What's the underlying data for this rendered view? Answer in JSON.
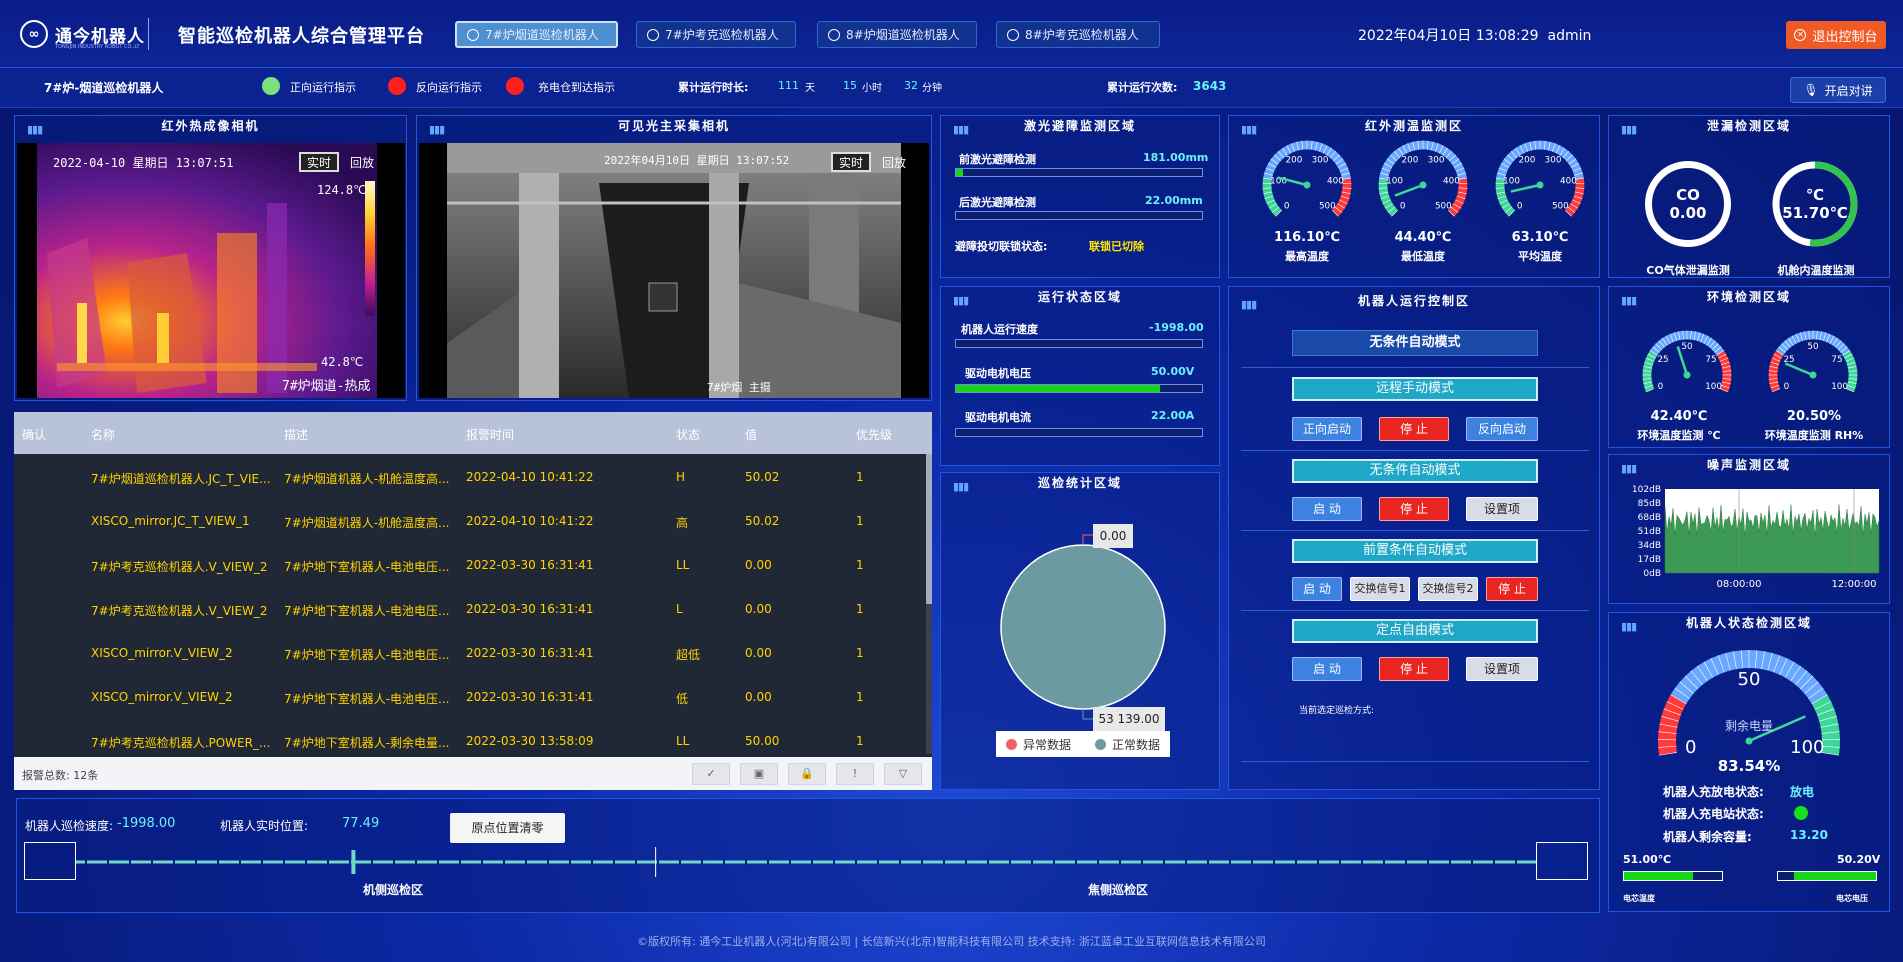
{
  "header": {
    "logo_mark": "∞",
    "logo_text": "通今机器人",
    "logo_sub": "TONGJIN INDUSTRY ROBOT CO.,LTD",
    "title": "智能巡检机器人综合管理平台",
    "tabs": [
      "7#炉烟道巡检机器人",
      "7#炉考克巡检机器人",
      "8#炉烟道巡检机器人",
      "8#炉考克巡检机器人"
    ],
    "active_tab": 0,
    "datetime": "2022年04月10日 13:08:29",
    "user": "admin",
    "logout": "退出控制台"
  },
  "status": {
    "robot_name": "7#炉-烟道巡检机器人",
    "legend": [
      {
        "label": "正向运行指示",
        "color": "#7de07d"
      },
      {
        "label": "反向运行指示",
        "color": "#ff1f1f"
      },
      {
        "label": "充电仓到达指示",
        "color": "#ff1f1f"
      }
    ],
    "runtime_label": "累计运行时长:",
    "days": "111",
    "days_unit": "天",
    "hours": "15",
    "hours_unit": "小时",
    "minutes": "32",
    "minutes_unit": "分钟",
    "count_label": "累计运行次数:",
    "count": "3643",
    "talk": "开启对讲"
  },
  "thermal": {
    "title": "红外热成像相机",
    "date": "2022-04-10 星期日 13:07:51",
    "live": "实时",
    "replay": "回放",
    "max": "124.8℃",
    "min": "42.8℃",
    "name": "7#炉烟道-热成"
  },
  "visible": {
    "title": "可见光主采集相机",
    "date": "2022年04月10日 星期日 13:07:52",
    "live": "实时",
    "replay": "回放",
    "name": "7#炉烟  主摄"
  },
  "alarms": {
    "columns": [
      "确认",
      "名称",
      "描述",
      "报警时间",
      "状态",
      "值",
      "优先级"
    ],
    "rows": [
      [
        "",
        "7#炉烟道巡检机器人.JC_T_VIE...",
        "7#炉烟道机器人-机舱温度高...",
        "2022-04-10 10:41:22",
        "H",
        "50.02",
        "1"
      ],
      [
        "",
        "XISCO_mirror.JC_T_VIEW_1",
        "7#炉烟道机器人-机舱温度高...",
        "2022-04-10 10:41:22",
        "高",
        "50.02",
        "1"
      ],
      [
        "",
        "7#炉考克巡检机器人.V_VIEW_2",
        "7#炉地下室机器人-电池电压...",
        "2022-03-30 16:31:41",
        "LL",
        "0.00",
        "1"
      ],
      [
        "",
        "7#炉考克巡检机器人.V_VIEW_2",
        "7#炉地下室机器人-电池电压...",
        "2022-03-30 16:31:41",
        "L",
        "0.00",
        "1"
      ],
      [
        "",
        "XISCO_mirror.V_VIEW_2",
        "7#炉地下室机器人-电池电压...",
        "2022-03-30 16:31:41",
        "超低",
        "0.00",
        "1"
      ],
      [
        "",
        "XISCO_mirror.V_VIEW_2",
        "7#炉地下室机器人-电池电压...",
        "2022-03-30 16:31:41",
        "低",
        "0.00",
        "1"
      ],
      [
        "",
        "7#炉考克巡检机器人.POWER_...",
        "7#炉地下室机器人-剩余电量...",
        "2022-03-30 13:58:09",
        "LL",
        "50.00",
        "1"
      ]
    ],
    "total": "报警总数: 12条",
    "tools": [
      "✓",
      "▣",
      "🔒",
      "!",
      "▽"
    ]
  },
  "laser": {
    "title": "激光避障监测区域",
    "front_label": "前激光避障检测",
    "front_value": "181.00mm",
    "front_pct": 0.03,
    "rear_label": "后激光避障检测",
    "rear_value": "22.00mm",
    "rear_pct": 0.0,
    "interlock_label": "避障投切联锁状态:",
    "interlock_value": "联锁已切除"
  },
  "runstate": {
    "title": "运行状态区域",
    "speed_label": "机器人运行速度",
    "speed_value": "-1998.00",
    "speed_pct": 0.0,
    "volt_label": "驱动电机电压",
    "volt_value": "50.00V",
    "volt_pct": 0.83,
    "curr_label": "驱动电机电流",
    "curr_value": "22.00A",
    "curr_pct": 0.0
  },
  "stats": {
    "title": "巡检统计区域",
    "abnormal_value": "0.00",
    "normal_value": "53 139.00",
    "legend_abnormal": "异常数据",
    "legend_normal": "正常数据",
    "color_abnormal": "#f06262",
    "color_normal": "#6b9aa0"
  },
  "infrared": {
    "title": "红外测温监测区",
    "gauges": [
      {
        "value": "116.10℃",
        "label": "最高温度",
        "pct": 0.22
      },
      {
        "value": "44.40℃",
        "label": "最低温度",
        "pct": 0.09
      },
      {
        "value": "63.10℃",
        "label": "平均温度",
        "pct": 0.12
      }
    ],
    "ticks": [
      "0",
      "100",
      "200",
      "300",
      "400",
      "500"
    ]
  },
  "control": {
    "title": "机器人运行控制区",
    "current_mode": "无条件自动模式",
    "modes": [
      {
        "name": "远程手动模式",
        "buttons": [
          "正向启动",
          "停 止",
          "反向启动"
        ]
      },
      {
        "name": "无条件自动模式",
        "buttons": [
          "启 动",
          "停 止",
          "设置项"
        ]
      },
      {
        "name": "前置条件自动模式",
        "buttons": [
          "启 动",
          "交换信号1",
          "交换信号2",
          "停 止"
        ]
      },
      {
        "name": "定点自由模式",
        "buttons": [
          "启 动",
          "停 止",
          "设置项"
        ]
      }
    ],
    "selected_label": "当前选定巡检方式:"
  },
  "leak": {
    "title": "泄漏检测区域",
    "co_label": "CO",
    "co_value": "0.00",
    "co_caption": "CO气体泄漏监测",
    "temp_unit": "℃",
    "temp_value": "51.70℃",
    "temp_caption": "机舱内温度监测",
    "temp_pct": 0.52
  },
  "env": {
    "title": "环境检测区域",
    "temp_value": "42.40℃",
    "temp_label": "环境温度监测 ℃",
    "temp_pct": 0.42,
    "hum_value": "20.50%",
    "hum_label": "环境温度监测 RH%",
    "hum_pct": 0.2,
    "ticks": [
      "0",
      "25",
      "50",
      "75",
      "100"
    ]
  },
  "noise": {
    "title": "噪声监测区域",
    "yticks": [
      "102dB",
      "85dB",
      "68dB",
      "51dB",
      "34dB",
      "17dB",
      "0dB"
    ],
    "xticks": [
      "08:00:00",
      "12:00:00"
    ]
  },
  "robotstate": {
    "title": "机器人状态检测区域",
    "gauge_label": "剩余电量",
    "battery_value": "83.54%",
    "battery_pct": 0.8354,
    "ticks": [
      "0",
      "50",
      "100"
    ],
    "charge_label": "机器人充放电状态:",
    "charge_value": "放电",
    "station_label": "机器人充电站状态:",
    "station_color": "#16e016",
    "capacity_label": "机器人剩余容量:",
    "capacity_value": "13.20",
    "cell_temp_value": "51.00℃",
    "cell_temp_pct": 0.7,
    "cell_temp_label": "电芯温度",
    "cell_volt_value": "50.20V",
    "cell_volt_pct": 0.84,
    "cell_volt_label": "电芯电压"
  },
  "track": {
    "speed_label": "机器人巡检速度:",
    "speed_value": "-1998.00",
    "pos_label": "机器人实时位置:",
    "pos_value": "77.49",
    "reset": "原点位置清零",
    "zone1": "机侧巡检区",
    "zone2": "焦侧巡检区",
    "position_pct": 0.19
  },
  "footer": "©版权所有: 通今工业机器人(河北)有限公司 | 长信新兴(北京)智能科技有限公司     技术支持: 浙江蓝卓工业互联网信息技术有限公司"
}
